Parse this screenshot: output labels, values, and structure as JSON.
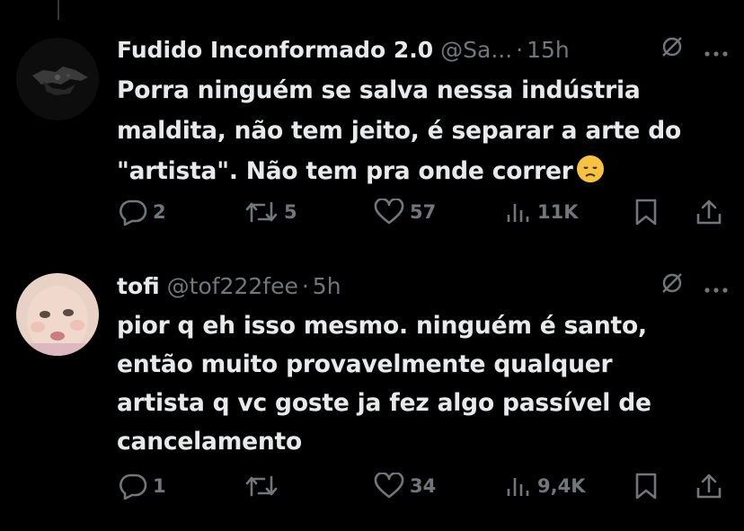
{
  "tweets": [
    {
      "name": "Fudido Inconformado 2.0",
      "handle": "@Sa...",
      "separator": "·",
      "time": "15h",
      "text_lines": [
        "Porra ninguém se salva nessa indústria",
        "maldita, não tem jeito, é separar a arte do",
        "\"artista\". Não tem pra onde correr"
      ],
      "emoji": "disappointed-face",
      "replies": "2",
      "retweets": "5",
      "likes": "57",
      "views": "11K"
    },
    {
      "name": "tofi",
      "handle": "@tof222fee",
      "separator": "·",
      "time": "5h",
      "text_lines": [
        "pior q eh isso mesmo. ninguém é santo,",
        "então muito provavelmente qualquer",
        "artista q vc goste ja fez algo passível de",
        "cancelamento"
      ],
      "replies": "1",
      "retweets": "",
      "likes": "34",
      "views": "9,4K"
    }
  ],
  "colors": {
    "background": "#000000",
    "text": "#e7e9ea",
    "muted": "#71767b",
    "thread_line": "#333639"
  },
  "icons": [
    "grok-icon",
    "more-icon",
    "reply-icon",
    "retweet-icon",
    "like-icon",
    "views-icon",
    "bookmark-icon",
    "share-icon"
  ]
}
